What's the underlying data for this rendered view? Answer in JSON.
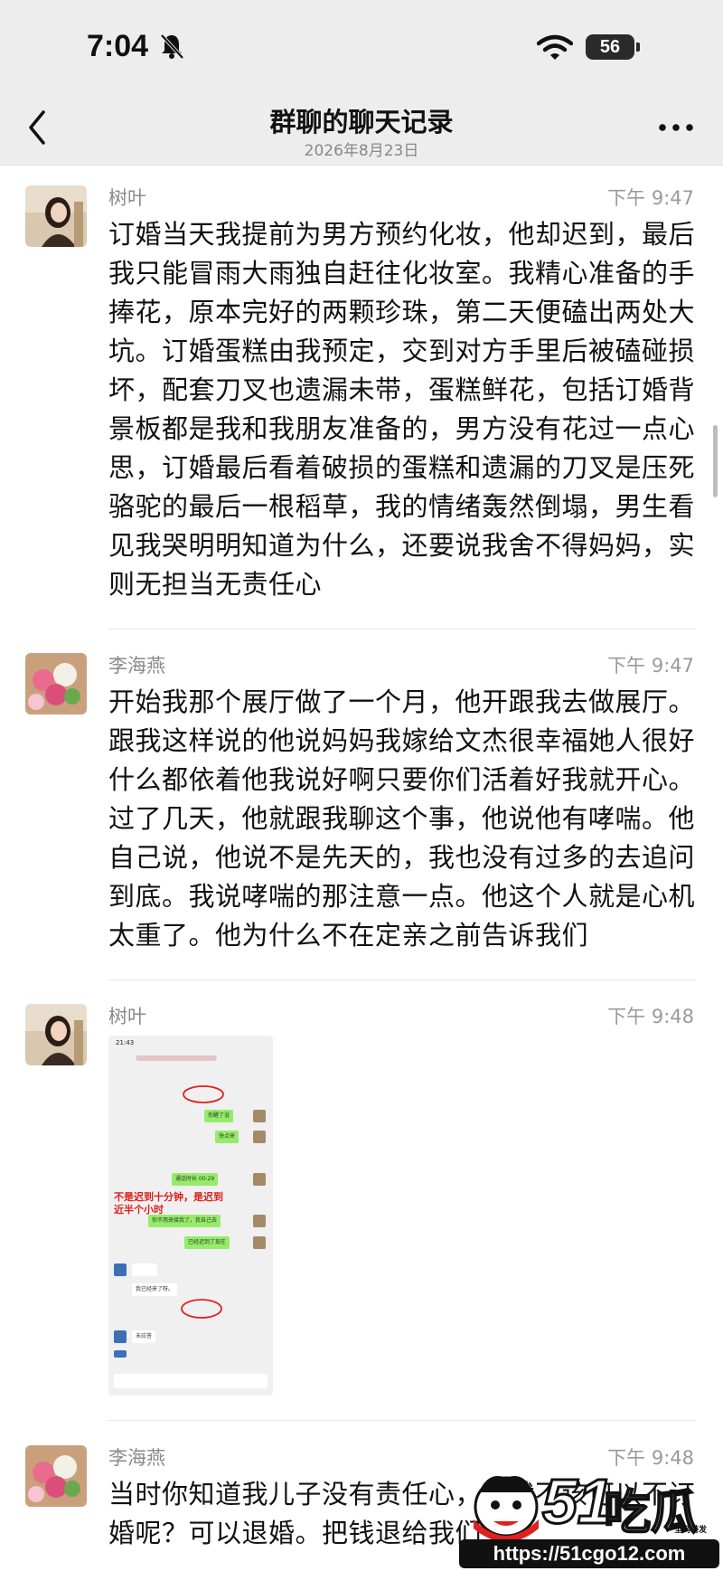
{
  "status_bar": {
    "time": "7:04",
    "battery": "56"
  },
  "header": {
    "title": "群聊的聊天记录",
    "date": "2026年8月23日"
  },
  "messages": [
    {
      "sender": "树叶",
      "time": "下午 9:47",
      "lines": [
        "订婚当天我提前为男方预约化妆，他却迟到，最后",
        "我只能冒雨大雨独自赶往化妆室。我精心准备的手",
        "捧花，原本完好的两颗珍珠，第二天便磕出两处大",
        "坑。订婚蛋糕由我预定，交到对方手里后被磕碰损",
        "坏，配套刀叉也遗漏未带，蛋糕鲜花，包括订婚背",
        "景板都是我和我朋友准备的，男方没有花过一点心",
        "思，订婚最后看着破损的蛋糕和遗漏的刀叉是压死",
        "骆驼的最后一根稻草，我的情绪轰然倒塌，男生看",
        "见我哭明明知道为什么，还要说我舍不得妈妈，实",
        "则无担当无责任心"
      ]
    },
    {
      "sender": "李海燕",
      "time": "下午 9:47",
      "lines": [
        "开始我那个展厅做了一个月，他开跟我去做展厅。",
        "跟我这样说的他说妈妈我嫁给文杰很幸福她人很好",
        "什么都依着他我说好啊只要你们活着好我就开心。",
        "过了几天，他就跟我聊这个事，他说他有哮喘。他",
        "自己说，他说不是先天的，我也没有过多的去追问",
        "到底。我说哮喘的那注意一点。他这个人就是心机",
        "太重了。他为什么不在定亲之前告诉我们"
      ]
    },
    {
      "sender": "树叶",
      "time": "下午 9:48",
      "screenshot": {
        "time": "21:43",
        "bubbles": [
          "你醒了没",
          "快点来",
          "通话时长 00:29",
          "你不用来接我了，我自己去",
          "已经迟到了现在"
        ],
        "left_bubbles": [
          "我已经来了呀。",
          "未应答"
        ],
        "annotation_line1": "不是迟到十分钟，是迟到",
        "annotation_line2": "近半个小时"
      }
    },
    {
      "sender": "李海燕",
      "time": "下午 9:48",
      "lines": [
        "当时你知道我儿子没有责任心，我就不该可以不订",
        "婚呢？可以退婚。把钱退给我们"
      ]
    }
  ],
  "watermark": {
    "brand_num": "51",
    "brand_text": "吃瓜",
    "tag": "全网首发",
    "url": "https://51cgo12.com"
  }
}
